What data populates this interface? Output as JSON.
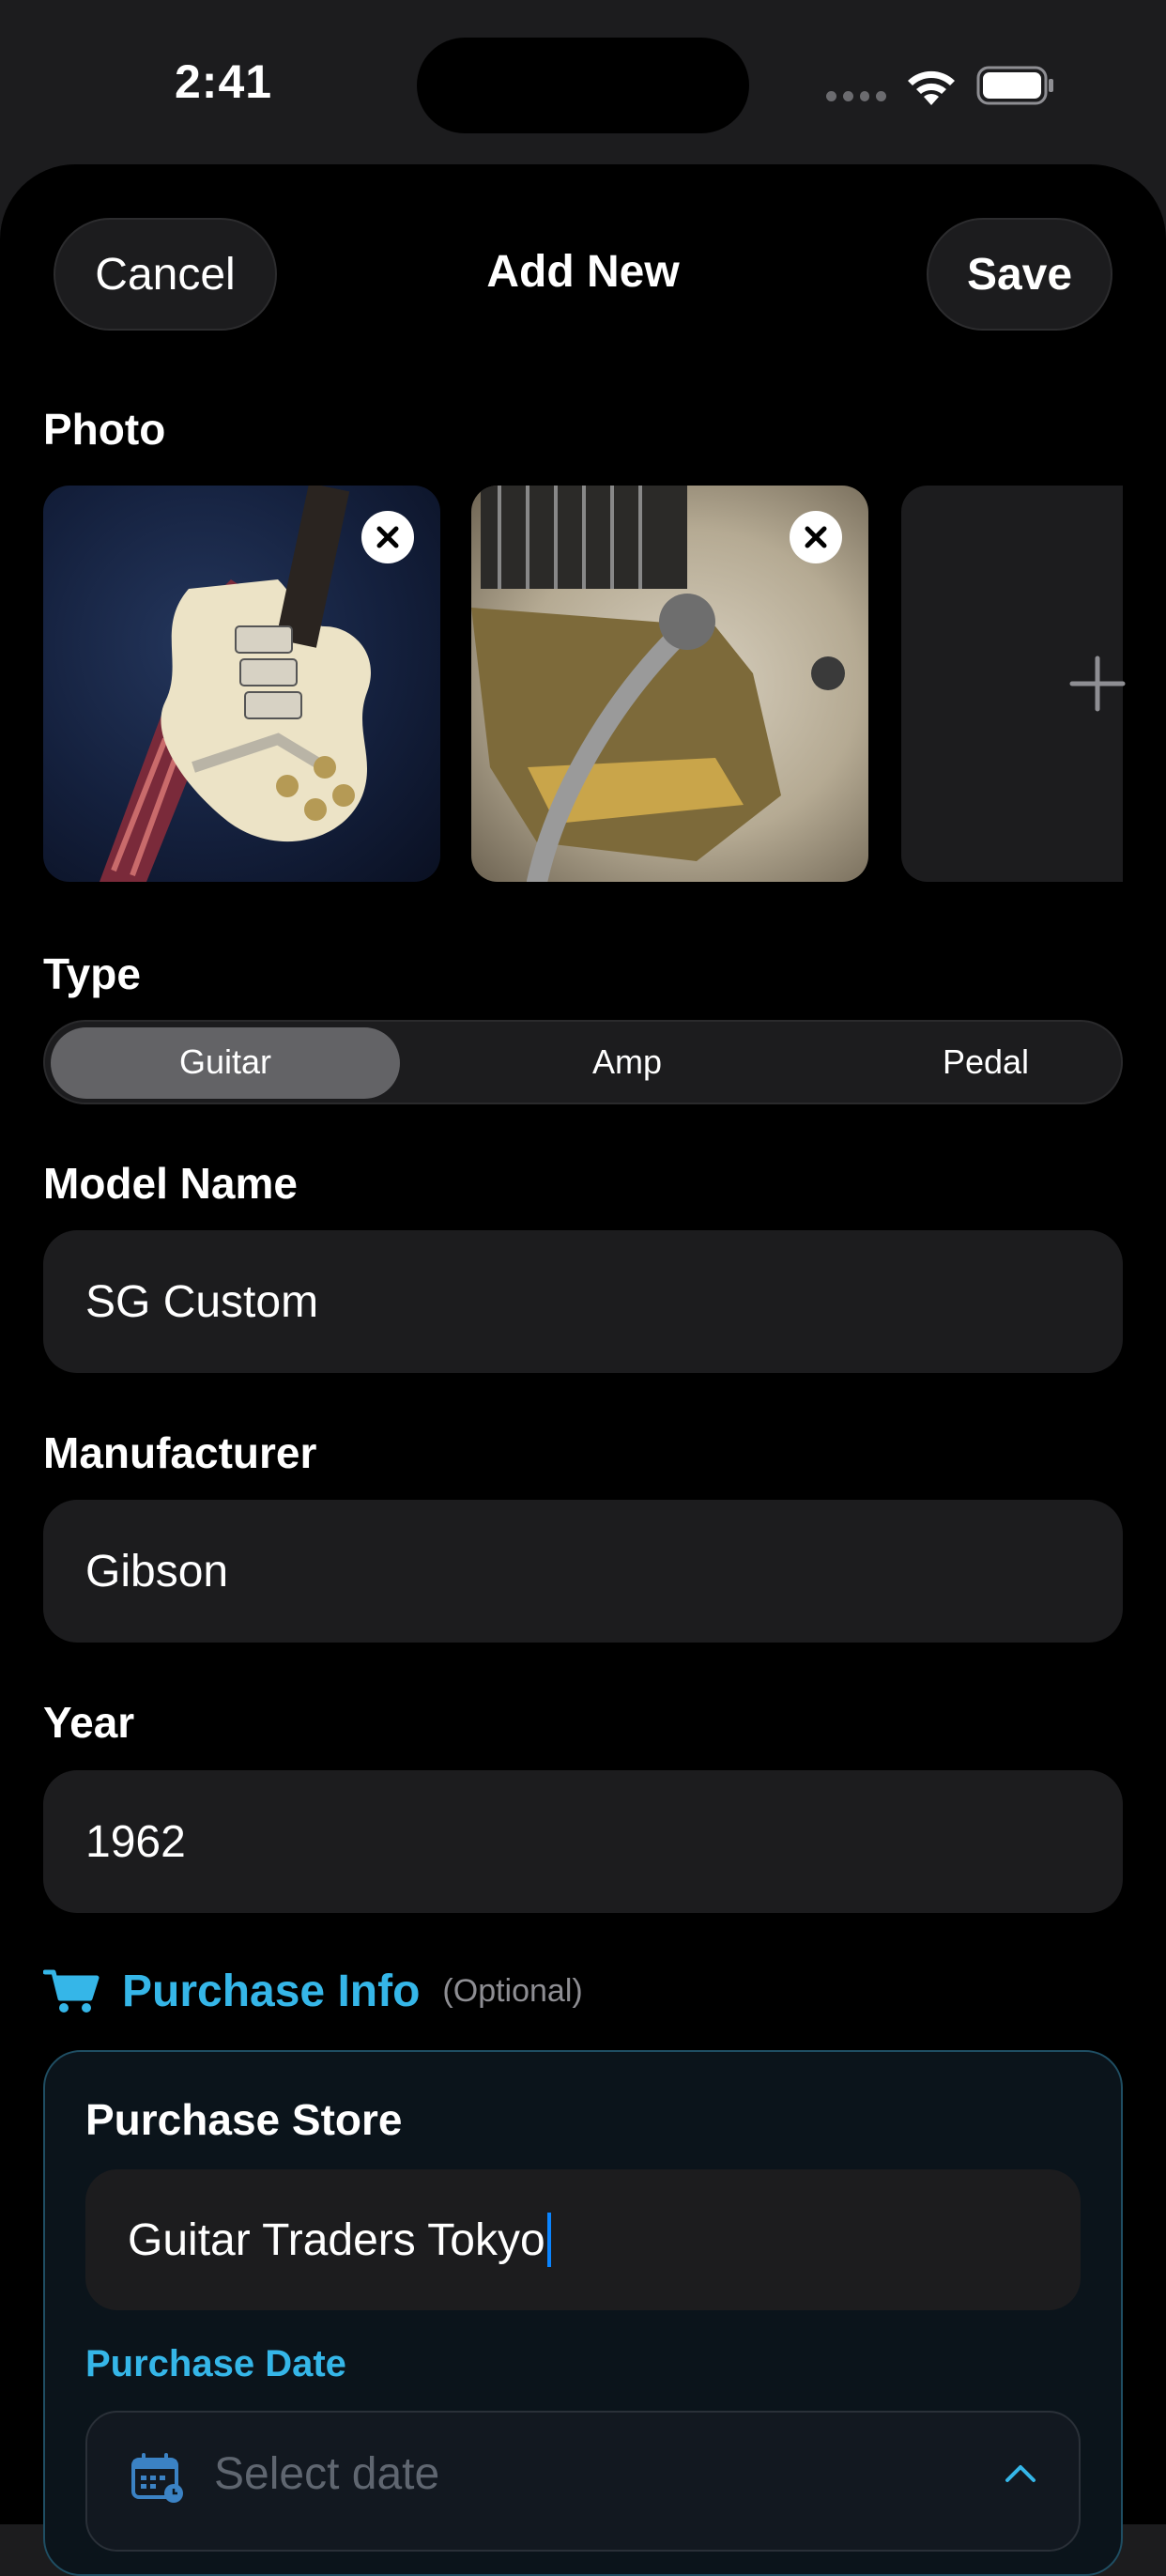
{
  "status_bar": {
    "time": "2:41"
  },
  "nav": {
    "cancel_label": "Cancel",
    "title": "Add New",
    "save_label": "Save"
  },
  "photo_section": {
    "label": "Photo"
  },
  "type_section": {
    "label": "Type",
    "options": [
      "Guitar",
      "Amp",
      "Pedal"
    ],
    "selected": "Guitar"
  },
  "model_name": {
    "label": "Model Name",
    "value": "SG Custom"
  },
  "manufacturer": {
    "label": "Manufacturer",
    "value": "Gibson"
  },
  "year": {
    "label": "Year",
    "value": "1962"
  },
  "purchase_info": {
    "title": "Purchase Info",
    "optional_note": "(Optional)",
    "store_label": "Purchase Store",
    "store_value": "Guitar Traders Tokyo",
    "date_label": "Purchase Date",
    "date_placeholder": "Select date"
  },
  "colors": {
    "accent": "#35b6e8",
    "background": "#000000",
    "field_bg": "#1c1c1e",
    "segment_active": "#636366",
    "caret": "#0a84ff"
  },
  "icons": [
    "wifi-icon",
    "battery-icon",
    "close-icon",
    "plus-icon",
    "cart-icon",
    "calendar-icon",
    "chevron-up-icon"
  ]
}
